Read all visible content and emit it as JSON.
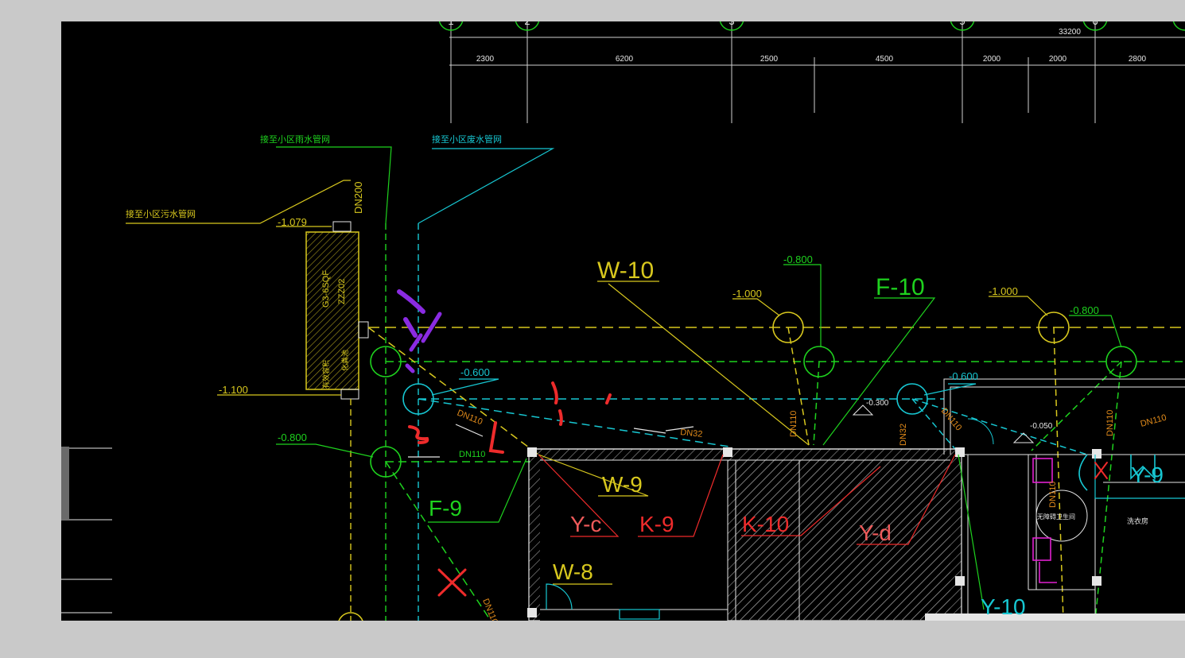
{
  "colors": {
    "background": "#000000",
    "frame": "#c9c9c9",
    "green": "#1ed21e",
    "cyan": "#17c7d2",
    "yellow": "#d8c81e",
    "red": "#ee2b2b",
    "purple": "#8a2be2",
    "white": "#e6e6e6",
    "orange": "#e08a1a"
  },
  "dimensions": {
    "total": "33200",
    "spans": [
      "2300",
      "6200",
      "2500",
      "4500",
      "2000",
      "2000",
      "2800"
    ]
  },
  "axis_bubbles": [
    "1",
    "2",
    "3",
    "5",
    "6"
  ],
  "pipe_labels": {
    "w10": "W-10",
    "f10": "F-10",
    "w9": "W-9",
    "y_c": "Y-c",
    "k9": "K-9",
    "k10": "K-10",
    "y_d": "Y-d",
    "f9": "F-9",
    "w8": "W-8",
    "y10": "Y-10",
    "y9": "Y-9"
  },
  "elevations": {
    "e1079": "-1.079",
    "e1100": "-1.100",
    "e0800_left": "-0.800",
    "e0600_left": "-0.600",
    "e0800_top": "-0.800",
    "e1000_mid": "-1.000",
    "e1000_right": "-1.000",
    "e0800_right": "-0.800",
    "e0600_right": "-0.600",
    "e0300": "-0.300",
    "e0050": "-0.050"
  },
  "diameters": {
    "dn200": "DN200",
    "dn110_a": "DN110",
    "dn110_b": "DN110",
    "dn32_a": "DN32",
    "dn110_c": "DN110",
    "dn32_b": "DN32",
    "dn110_d": "DN110",
    "dn110_e": "DN110",
    "dn110_f": "DN110",
    "dn110_g": "DN110",
    "dn110_h": "DN110"
  },
  "notes": {
    "to_rain_pipe": "接至小区雨水管网",
    "to_sewer_pipe": "接至小区污水管网",
    "to_waste_pipe": "接至小区废水管网",
    "tank_code": "G3-6SQF",
    "tank_code2": "ZZZ02",
    "tank_note": "有效容积",
    "tank_note2": "化粪池",
    "room_toilet": "无障碍卫生间",
    "room_wash": "洗衣房"
  }
}
